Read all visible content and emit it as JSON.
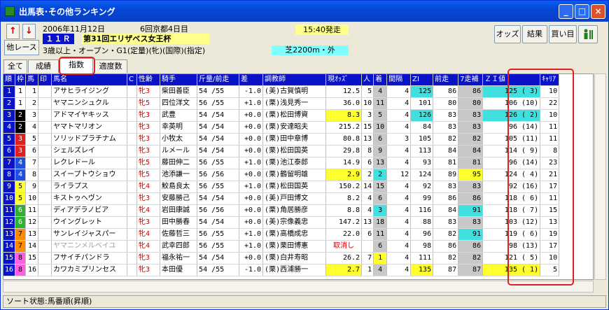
{
  "window": {
    "title": "出馬表･その他ランキング"
  },
  "header": {
    "date": "2006年11月12日",
    "meeting": "6回京都4日目",
    "post_time": "15:40発走",
    "race_number": "１１Ｒ",
    "race_name": "第31回エリザベス女王杯",
    "conditions": "3歳以上・オープン・G1(定量)(牝)(国際)(指定)",
    "course": "芝2200m・外",
    "race_button": "他レース",
    "prev_arrow": "↑",
    "next_arrow": "↓"
  },
  "toolbar": {
    "odds": "オッズ",
    "result": "結果",
    "buy": "買い目"
  },
  "tabs": [
    "全て",
    "成績",
    "指数",
    "適度数"
  ],
  "columns": [
    "順",
    "枠",
    "馬",
    "印",
    "馬名",
    "C",
    "性齢",
    "騎手",
    "斤量/前走",
    "差",
    "調教師",
    "現ｵｯｽﾞ",
    "人",
    "着",
    "間隔",
    "ZI",
    "前走",
    "7走補",
    "ＺＩ値",
    "ｷｬﾘｱ"
  ],
  "rows": [
    {
      "n": "1",
      "w": "1",
      "u": "1",
      "name": "アサヒライジング",
      "sex": "牝3",
      "jockey": "柴田善臣",
      "kin": "54",
      "prev": "/55",
      "diff": "-1.0",
      "trainer": "(美)古賀慎明",
      "odds": "12.5",
      "pop": "5",
      "chaku": "4",
      "interval": "4",
      "zi": "125",
      "zen": "86",
      "hosei": "86",
      "ziv": "125 ( 3)",
      "career": "10"
    },
    {
      "n": "2",
      "w": "1",
      "u": "2",
      "name": "ヤマニンシュクル",
      "sex": "牝5",
      "jockey": "四位洋文",
      "kin": "56",
      "prev": "/55",
      "diff": "+1.0",
      "trainer": "(栗)浅見秀一",
      "odds": "36.0",
      "pop": "10",
      "chaku": "11",
      "interval": "4",
      "zi": "101",
      "zen": "80",
      "hosei": "80",
      "ziv": "106 (10)",
      "career": "22"
    },
    {
      "n": "3",
      "w": "2",
      "u": "3",
      "name": "アドマイヤキッス",
      "sex": "牝3",
      "jockey": "武豊",
      "kin": "54",
      "prev": "/54",
      "diff": "+0.0",
      "trainer": "(栗)松田博資",
      "odds": "8.3",
      "pop": "3",
      "chaku": "5",
      "interval": "4",
      "zi": "126",
      "zen": "83",
      "hosei": "83",
      "ziv": "126 ( 2)",
      "career": "10"
    },
    {
      "n": "4",
      "w": "2",
      "u": "4",
      "name": "ヤマトマリオン",
      "sex": "牝3",
      "jockey": "幸英明",
      "kin": "54",
      "prev": "/54",
      "diff": "+0.0",
      "trainer": "(栗)安達昭夫",
      "odds": "215.2",
      "pop": "15",
      "chaku": "10",
      "interval": "4",
      "zi": "84",
      "zen": "83",
      "hosei": "83",
      "ziv": "96 (14)",
      "career": "11"
    },
    {
      "n": "5",
      "w": "3",
      "u": "5",
      "name": "ソリッドプラチナム",
      "sex": "牝3",
      "jockey": "小牧太",
      "kin": "54",
      "prev": "/54",
      "diff": "+0.0",
      "trainer": "(栗)田中章博",
      "odds": "80.8",
      "pop": "13",
      "chaku": "6",
      "interval": "3",
      "zi": "105",
      "zen": "82",
      "hosei": "82",
      "ziv": "105 (11)",
      "career": "11"
    },
    {
      "n": "6",
      "w": "3",
      "u": "6",
      "name": "シェルズレイ",
      "sex": "牝3",
      "jockey": "ルメール",
      "kin": "54",
      "prev": "/54",
      "diff": "+0.0",
      "trainer": "(栗)松田国英",
      "odds": "29.8",
      "pop": "8",
      "chaku": "9",
      "interval": "4",
      "zi": "113",
      "zen": "84",
      "hosei": "84",
      "ziv": "114 ( 9)",
      "career": "8"
    },
    {
      "n": "7",
      "w": "4",
      "u": "7",
      "name": "レクレドール",
      "sex": "牝5",
      "jockey": "藤田伸二",
      "kin": "56",
      "prev": "/55",
      "diff": "+1.0",
      "trainer": "(栗)池江泰郎",
      "odds": "14.9",
      "pop": "6",
      "chaku": "13",
      "interval": "4",
      "zi": "93",
      "zen": "81",
      "hosei": "81",
      "ziv": "96 (14)",
      "career": "23"
    },
    {
      "n": "8",
      "w": "4",
      "u": "8",
      "name": "スイープトウショウ",
      "sex": "牝5",
      "jockey": "池添謙一",
      "kin": "56",
      "prev": "/56",
      "diff": "+0.0",
      "trainer": "(栗)鶴留明雄",
      "odds": "2.9",
      "pop": "2",
      "chaku": "2",
      "interval": "12",
      "zi": "124",
      "zen": "89",
      "hosei": "95",
      "ziv": "124 ( 4)",
      "career": "21"
    },
    {
      "n": "9",
      "w": "5",
      "u": "9",
      "name": "ライラプス",
      "sex": "牝4",
      "jockey": "鮫島良太",
      "kin": "56",
      "prev": "/55",
      "diff": "+1.0",
      "trainer": "(栗)松田国英",
      "odds": "150.2",
      "pop": "14",
      "chaku": "15",
      "interval": "4",
      "zi": "92",
      "zen": "83",
      "hosei": "83",
      "ziv": "92 (16)",
      "career": "17"
    },
    {
      "n": "10",
      "w": "5",
      "u": "10",
      "name": "キストゥヘヴン",
      "sex": "牝3",
      "jockey": "安藤勝己",
      "kin": "54",
      "prev": "/54",
      "diff": "+0.0",
      "trainer": "(美)戸田博文",
      "odds": "8.2",
      "pop": "4",
      "chaku": "6",
      "interval": "4",
      "zi": "99",
      "zen": "86",
      "hosei": "86",
      "ziv": "118 ( 6)",
      "career": "11"
    },
    {
      "n": "11",
      "w": "6",
      "u": "11",
      "name": "ディアデラノビア",
      "sex": "牝4",
      "jockey": "岩田康誠",
      "kin": "56",
      "prev": "/56",
      "diff": "+0.0",
      "trainer": "(栗)角居勝彦",
      "odds": "8.8",
      "pop": "4",
      "chaku": "3",
      "interval": "4",
      "zi": "116",
      "zen": "84",
      "hosei": "91",
      "ziv": "118 ( 7)",
      "career": "15"
    },
    {
      "n": "12",
      "w": "6",
      "u": "12",
      "name": "ウイングレット",
      "sex": "牝3",
      "jockey": "田中勝春",
      "kin": "54",
      "prev": "/54",
      "diff": "+0.0",
      "trainer": "(美)宗像義忠",
      "odds": "147.2",
      "pop": "13",
      "chaku": "18",
      "interval": "4",
      "zi": "88",
      "zen": "83",
      "hosei": "83",
      "ziv": "103 (12)",
      "career": "13"
    },
    {
      "n": "13",
      "w": "7",
      "u": "13",
      "name": "サンレイジャスパー",
      "sex": "牝4",
      "jockey": "佐藤哲三",
      "kin": "56",
      "prev": "/55",
      "diff": "+1.0",
      "trainer": "(栗)高橋成忠",
      "odds": "22.0",
      "pop": "6",
      "chaku": "11",
      "interval": "4",
      "zi": "96",
      "zen": "82",
      "hosei": "91",
      "ziv": "119 ( 6)",
      "career": "19"
    },
    {
      "n": "14",
      "w": "7",
      "u": "14",
      "name": "ヤマニンメルベイユ",
      "sex": "牝4",
      "jockey": "武幸四郎",
      "kin": "56",
      "prev": "/55",
      "diff": "+1.0",
      "trainer": "(栗)栗田博憲",
      "odds": "取消し",
      "pop": "",
      "chaku": "6",
      "interval": "4",
      "zi": "98",
      "zen": "86",
      "hosei": "86",
      "ziv": "98 (13)",
      "career": "17",
      "scratched": true
    },
    {
      "n": "15",
      "w": "8",
      "u": "15",
      "name": "フサイチパンドラ",
      "sex": "牝3",
      "jockey": "福永祐一",
      "kin": "54",
      "prev": "/54",
      "diff": "+0.0",
      "trainer": "(栗)白井寿昭",
      "odds": "26.2",
      "pop": "7",
      "chaku": "1",
      "interval": "4",
      "zi": "111",
      "zen": "82",
      "hosei": "82",
      "ziv": "121 ( 5)",
      "career": "10"
    },
    {
      "n": "16",
      "w": "8",
      "u": "16",
      "name": "カワカミプリンセス",
      "sex": "牝3",
      "jockey": "本田優",
      "kin": "54",
      "prev": "/55",
      "diff": "-1.0",
      "trainer": "(栗)西浦勝一",
      "odds": "2.7",
      "pop": "1",
      "chaku": "4",
      "interval": "4",
      "zi": "135",
      "zen": "87",
      "hosei": "87",
      "ziv": "135 ( 1)",
      "career": "5"
    }
  ],
  "colors": {
    "waku": [
      "#ffffff",
      "#000000",
      "#e02020",
      "#1e50e0",
      "#ffff30",
      "#30b030",
      "#ff8c00",
      "#ff60e0"
    ],
    "highlight_yellow": "#ffff30",
    "highlight_cyan": "#40e0e0",
    "header_blue": "#0b13c9"
  },
  "status": "ソート状態:馬番順(昇順)"
}
